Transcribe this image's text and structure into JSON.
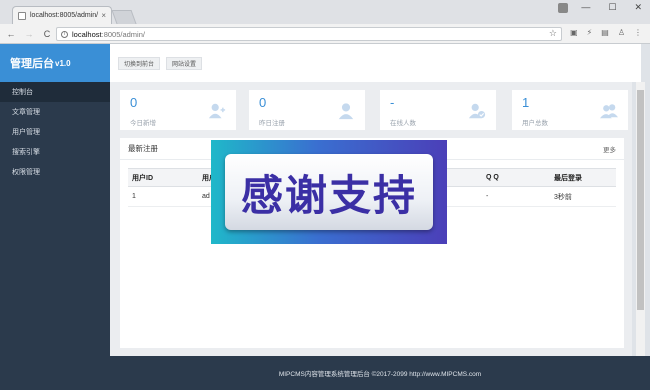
{
  "browser": {
    "tab_title": "localhost:8005/admin/",
    "tab_close": "×",
    "url_host": "localhost",
    "url_path": ":8005/admin/",
    "window_controls": [
      "—",
      "☐",
      "✕"
    ],
    "nav": {
      "back": "←",
      "forward": "→",
      "reload": "C"
    }
  },
  "sidebar": {
    "brand": "管理后台",
    "version": "v1.0",
    "items": [
      {
        "label": "控制台"
      },
      {
        "label": "文章管理"
      },
      {
        "label": "用户管理"
      },
      {
        "label": "搜索引擎"
      },
      {
        "label": "权限管理"
      }
    ]
  },
  "topbar": {
    "buttons": [
      {
        "label": "切换到前台"
      },
      {
        "label": "网站设置"
      }
    ]
  },
  "stats": [
    {
      "value": "0",
      "label": "今日新增",
      "icon": "add-user-icon"
    },
    {
      "value": "0",
      "label": "昨日注册",
      "icon": "user-icon"
    },
    {
      "value": "-",
      "label": "在线人数",
      "icon": "user-check-icon"
    },
    {
      "value": "1",
      "label": "用户总数",
      "icon": "users-icon"
    }
  ],
  "panel": {
    "title": "最新注册",
    "more": "更多",
    "columns": [
      "用户ID",
      "用户",
      "",
      "Q Q",
      "最后登录"
    ],
    "rows": [
      [
        "1",
        "ad",
        "",
        "-",
        "3秒前"
      ]
    ]
  },
  "footer": {
    "text": "MIPCMS内容管理系统管理后台 ©2017-2099 http://www.MIPCMS.com"
  },
  "overlay": {
    "text": "感谢支持"
  },
  "colors": {
    "accent": "#3a8fd6",
    "sidebar": "#2b3a4c",
    "overlay_text": "#3b2fa5"
  }
}
